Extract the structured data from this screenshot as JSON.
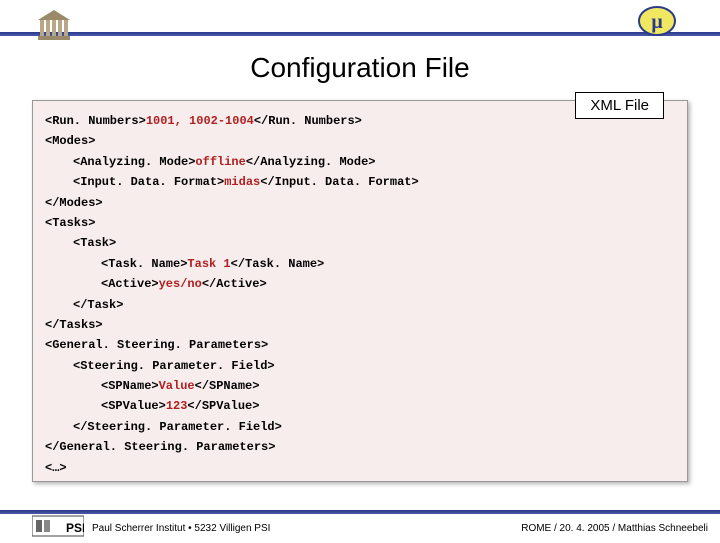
{
  "title": "Configuration File",
  "xml_label": "XML File",
  "code": {
    "run_open": "<Run. Numbers>",
    "run_val": "1001, 1002-1004",
    "run_close": "</Run. Numbers>",
    "modes_open": "<Modes>",
    "am_open": "<Analyzing. Mode>",
    "am_val": "offline",
    "am_close": "</Analyzing. Mode>",
    "idf_open": "<Input. Data. Format>",
    "idf_val": "midas",
    "idf_close": "</Input. Data. Format>",
    "modes_close": "</Modes>",
    "tasks_open": "<Tasks>",
    "task_open": "<Task>",
    "tn_open": "<Task. Name>",
    "tn_val": "Task 1",
    "tn_close": "</Task. Name>",
    "ac_open": "<Active>",
    "ac_val": "yes/no",
    "ac_close": "</Active>",
    "task_close": "</Task>",
    "tasks_close": "</Tasks>",
    "gsp_open": "<General. Steering. Parameters>",
    "spf_open": "<Steering. Parameter. Field>",
    "spn_open": "<SPName>",
    "spn_val": "Value",
    "spn_close": "</SPName>",
    "spv_open": "<SPValue>",
    "spv_val": "123",
    "spv_close": "</SPValue>",
    "spf_close": "</Steering. Parameter. Field>",
    "gsp_close": "</General. Steering. Parameters>",
    "ellipsis": "<…>"
  },
  "footer": {
    "left": "Paul Scherrer Institut • 5232 Villigen PSI",
    "right": "ROME / 20. 4. 2005 / Matthias Schneebeli"
  }
}
